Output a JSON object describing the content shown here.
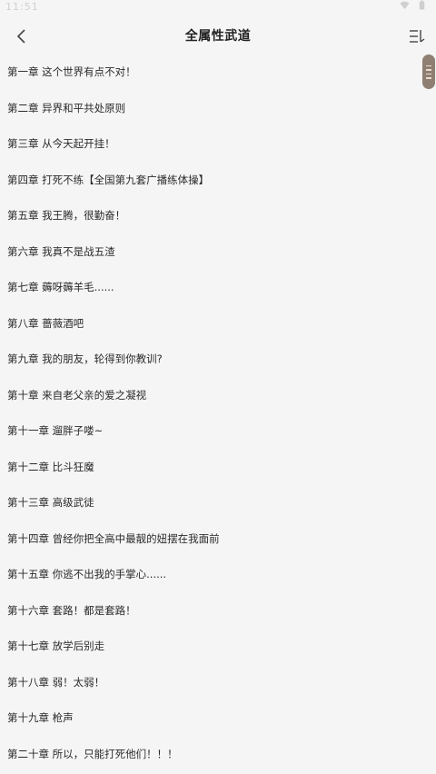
{
  "status_bar": {
    "time": "11:51",
    "icons": [
      "notification-icon",
      "wifi-icon",
      "battery-icon"
    ]
  },
  "header": {
    "title": "全属性武道",
    "back_icon": "chevron-left-icon",
    "menu_icon": "table-of-contents-icon"
  },
  "chapters": [
    "第一章 这个世界有点不对！",
    "第二章 异界和平共处原则",
    "第三章 从今天起开挂！",
    "第四章 打死不练【全国第九套广播练体操】",
    "第五章 我王腾，很勤奋！",
    "第六章 我真不是战五渣",
    "第七章 薅呀薅羊毛......",
    "第八章 蔷薇酒吧",
    "第九章 我的朋友，轮得到你教训?",
    "第十章 来自老父亲的爱之凝视",
    "第十一章 遛胖子喽~",
    "第十二章 比斗狂魔",
    "第十三章 高级武徒",
    "第十四章 曾经你把全高中最靓的妞摆在我面前",
    "第十五章 你逃不出我的手掌心......",
    "第十六章 套路！都是套路！",
    "第十七章 放学后别走",
    "第十八章 弱！太弱！",
    "第十九章 枪声",
    "第二十章 所以，只能打死他们！！！"
  ],
  "colors": {
    "background": "#f5f5f5",
    "text": "#2a2a2a",
    "scroll_handle": "#8e7f72"
  }
}
